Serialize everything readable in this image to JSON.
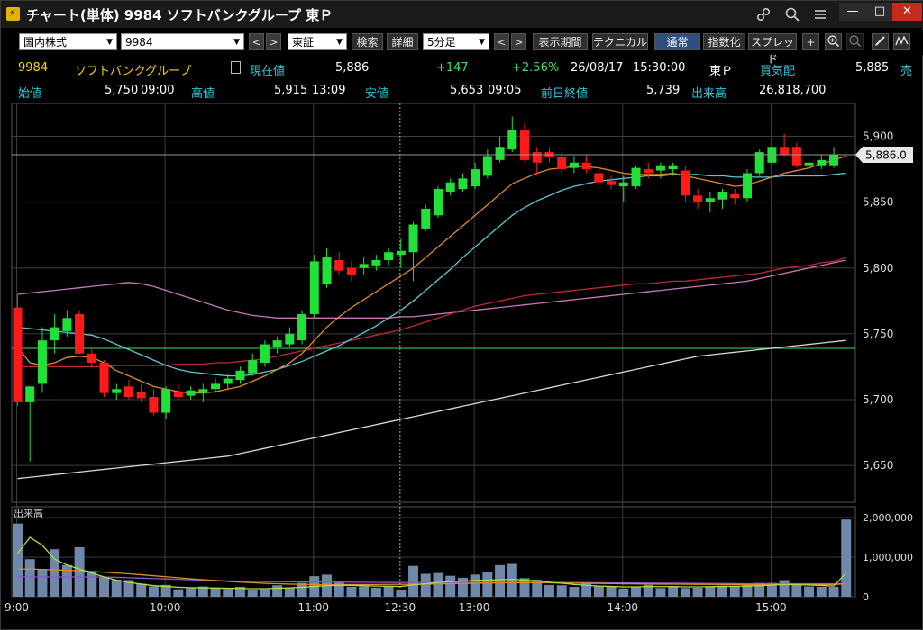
{
  "window": {
    "title": "チャート(単体) 9984 ソフトバンクグループ 東Ｐ",
    "icons": [
      "link-icon",
      "search-icon",
      "menu-icon"
    ],
    "minimize": "—",
    "maximize": "□",
    "close": "✕"
  },
  "toolbar": {
    "market_select": "国内株式",
    "code_input": "9984",
    "exchange_select": "東証",
    "search_button": "検索",
    "detail_button": "詳細",
    "interval_select": "5分足",
    "period_button": "表示期間",
    "technical_button": "テクニカル",
    "normal_button": "通常",
    "index_button": "指数化",
    "spread_button": "スプレッド"
  },
  "quote": {
    "code": "9984",
    "name": "ソフトバンクグループ",
    "current_label": "現在値",
    "current_value": "5,886",
    "change": "+147",
    "change_pct": "+2.56%",
    "date": "26/08/17",
    "time": "15:30:00",
    "market": "東Ｐ",
    "bid_label": "買気配",
    "bid_value": "5,885",
    "bid_suffix": "売",
    "open_label": "始値",
    "open_value": "5,750",
    "open_time": "09:00",
    "high_label": "高値",
    "high_value": "5,915",
    "high_time": "13:09",
    "low_label": "安値",
    "low_value": "5,653",
    "low_time": "09:05",
    "prev_label": "前日終値",
    "prev_value": "5,739",
    "volume_label": "出来高",
    "volume_value": "26,818,700"
  },
  "chart_data": {
    "type": "candlestick",
    "price_ticks": [
      "5,650",
      "5,700",
      "5,750",
      "5,800",
      "5,850",
      "5,900"
    ],
    "price_tick_values": [
      5650,
      5700,
      5750,
      5800,
      5850,
      5900
    ],
    "ylim": [
      5622,
      5925
    ],
    "current_price_label": "5,886.0",
    "current_price": 5886,
    "prev_close": 5739,
    "volume_label": "出来高",
    "volume_ticks": [
      "2,000,000",
      "1,000,000",
      "0"
    ],
    "volume_tick_values": [
      2000000,
      1000000,
      0
    ],
    "volume_max": 2000000,
    "time_labels": [
      "9:00",
      "10:00",
      "11:00",
      "12:30",
      "13:00",
      "14:00",
      "15:00"
    ],
    "time_label_index": [
      0,
      12,
      24,
      31,
      37,
      49,
      61
    ],
    "colors": {
      "up": "#22e03a",
      "down": "#ff1a1a",
      "ma1": "#e08a2a",
      "ma2": "#5ac8d8",
      "ma3": "#c0283a",
      "ma4": "#c878b8",
      "ma5": "#d8d8d8",
      "prev_close": "#3ce05a",
      "volume": "#6f87a8"
    },
    "candles": [
      {
        "o": 5770,
        "h": 5780,
        "l": 5695,
        "c": 5698
      },
      {
        "o": 5698,
        "h": 5710,
        "l": 5653,
        "c": 5710
      },
      {
        "o": 5712,
        "h": 5755,
        "l": 5705,
        "c": 5745
      },
      {
        "o": 5745,
        "h": 5765,
        "l": 5735,
        "c": 5755
      },
      {
        "o": 5752,
        "h": 5768,
        "l": 5748,
        "c": 5762
      },
      {
        "o": 5765,
        "h": 5768,
        "l": 5735,
        "c": 5735
      },
      {
        "o": 5735,
        "h": 5740,
        "l": 5725,
        "c": 5728
      },
      {
        "o": 5728,
        "h": 5730,
        "l": 5702,
        "c": 5705
      },
      {
        "o": 5705,
        "h": 5712,
        "l": 5700,
        "c": 5708
      },
      {
        "o": 5710,
        "h": 5715,
        "l": 5700,
        "c": 5702
      },
      {
        "o": 5706,
        "h": 5712,
        "l": 5698,
        "c": 5701
      },
      {
        "o": 5702,
        "h": 5708,
        "l": 5688,
        "c": 5690
      },
      {
        "o": 5690,
        "h": 5710,
        "l": 5685,
        "c": 5708
      },
      {
        "o": 5706,
        "h": 5712,
        "l": 5700,
        "c": 5702
      },
      {
        "o": 5703,
        "h": 5710,
        "l": 5700,
        "c": 5707
      },
      {
        "o": 5705,
        "h": 5712,
        "l": 5698,
        "c": 5708
      },
      {
        "o": 5708,
        "h": 5716,
        "l": 5705,
        "c": 5712
      },
      {
        "o": 5712,
        "h": 5720,
        "l": 5708,
        "c": 5716
      },
      {
        "o": 5715,
        "h": 5725,
        "l": 5712,
        "c": 5722
      },
      {
        "o": 5720,
        "h": 5735,
        "l": 5718,
        "c": 5730
      },
      {
        "o": 5728,
        "h": 5745,
        "l": 5725,
        "c": 5742
      },
      {
        "o": 5740,
        "h": 5748,
        "l": 5735,
        "c": 5745
      },
      {
        "o": 5742,
        "h": 5755,
        "l": 5740,
        "c": 5750
      },
      {
        "o": 5745,
        "h": 5768,
        "l": 5742,
        "c": 5765
      },
      {
        "o": 5765,
        "h": 5810,
        "l": 5762,
        "c": 5805
      },
      {
        "o": 5788,
        "h": 5815,
        "l": 5785,
        "c": 5808
      },
      {
        "o": 5806,
        "h": 5812,
        "l": 5795,
        "c": 5798
      },
      {
        "o": 5800,
        "h": 5805,
        "l": 5790,
        "c": 5795
      },
      {
        "o": 5800,
        "h": 5808,
        "l": 5795,
        "c": 5803
      },
      {
        "o": 5802,
        "h": 5810,
        "l": 5798,
        "c": 5806
      },
      {
        "o": 5806,
        "h": 5815,
        "l": 5802,
        "c": 5812
      },
      {
        "o": 5810,
        "h": 5822,
        "l": 5800,
        "c": 5813
      },
      {
        "o": 5812,
        "h": 5835,
        "l": 5790,
        "c": 5833
      },
      {
        "o": 5830,
        "h": 5848,
        "l": 5828,
        "c": 5845
      },
      {
        "o": 5840,
        "h": 5862,
        "l": 5838,
        "c": 5860
      },
      {
        "o": 5858,
        "h": 5868,
        "l": 5855,
        "c": 5865
      },
      {
        "o": 5860,
        "h": 5872,
        "l": 5858,
        "c": 5868
      },
      {
        "o": 5862,
        "h": 5880,
        "l": 5860,
        "c": 5875
      },
      {
        "o": 5870,
        "h": 5890,
        "l": 5868,
        "c": 5885
      },
      {
        "o": 5882,
        "h": 5900,
        "l": 5880,
        "c": 5892
      },
      {
        "o": 5890,
        "h": 5915,
        "l": 5888,
        "c": 5905
      },
      {
        "o": 5905,
        "h": 5910,
        "l": 5880,
        "c": 5882
      },
      {
        "o": 5888,
        "h": 5892,
        "l": 5870,
        "c": 5880
      },
      {
        "o": 5888,
        "h": 5892,
        "l": 5880,
        "c": 5884
      },
      {
        "o": 5884,
        "h": 5888,
        "l": 5872,
        "c": 5875
      },
      {
        "o": 5876,
        "h": 5885,
        "l": 5872,
        "c": 5880
      },
      {
        "o": 5880,
        "h": 5886,
        "l": 5872,
        "c": 5875
      },
      {
        "o": 5872,
        "h": 5876,
        "l": 5862,
        "c": 5865
      },
      {
        "o": 5866,
        "h": 5870,
        "l": 5860,
        "c": 5863
      },
      {
        "o": 5862,
        "h": 5870,
        "l": 5850,
        "c": 5865
      },
      {
        "o": 5862,
        "h": 5878,
        "l": 5860,
        "c": 5876
      },
      {
        "o": 5875,
        "h": 5880,
        "l": 5868,
        "c": 5872
      },
      {
        "o": 5874,
        "h": 5880,
        "l": 5868,
        "c": 5878
      },
      {
        "o": 5875,
        "h": 5880,
        "l": 5870,
        "c": 5878
      },
      {
        "o": 5874,
        "h": 5878,
        "l": 5850,
        "c": 5855
      },
      {
        "o": 5855,
        "h": 5860,
        "l": 5845,
        "c": 5850
      },
      {
        "o": 5850,
        "h": 5858,
        "l": 5842,
        "c": 5853
      },
      {
        "o": 5852,
        "h": 5860,
        "l": 5845,
        "c": 5858
      },
      {
        "o": 5856,
        "h": 5860,
        "l": 5848,
        "c": 5853
      },
      {
        "o": 5853,
        "h": 5875,
        "l": 5850,
        "c": 5872
      },
      {
        "o": 5872,
        "h": 5890,
        "l": 5870,
        "c": 5888
      },
      {
        "o": 5880,
        "h": 5898,
        "l": 5878,
        "c": 5892
      },
      {
        "o": 5892,
        "h": 5902,
        "l": 5885,
        "c": 5886
      },
      {
        "o": 5892,
        "h": 5895,
        "l": 5876,
        "c": 5878
      },
      {
        "o": 5878,
        "h": 5885,
        "l": 5874,
        "c": 5880
      },
      {
        "o": 5878,
        "h": 5886,
        "l": 5875,
        "c": 5882
      },
      {
        "o": 5878,
        "h": 5892,
        "l": 5876,
        "c": 5886
      }
    ],
    "volumes": [
      1850000,
      950000,
      700000,
      1200000,
      800000,
      1250000,
      620000,
      500000,
      430000,
      420000,
      330000,
      260000,
      300000,
      190000,
      220000,
      260000,
      230000,
      200000,
      250000,
      170000,
      190000,
      290000,
      230000,
      350000,
      520000,
      560000,
      400000,
      250000,
      260000,
      230000,
      280000,
      160000,
      780000,
      580000,
      600000,
      530000,
      480000,
      560000,
      630000,
      800000,
      830000,
      470000,
      430000,
      300000,
      290000,
      250000,
      330000,
      270000,
      250000,
      210000,
      250000,
      300000,
      220000,
      270000,
      220000,
      230000,
      250000,
      280000,
      270000,
      310000,
      350000,
      350000,
      420000,
      330000,
      260000,
      250000,
      250000,
      1950000
    ],
    "ma_fast": [
      5740,
      5728,
      5726,
      5728,
      5732,
      5733,
      5732,
      5728,
      5722,
      5718,
      5714,
      5710,
      5708,
      5706,
      5705,
      5705,
      5706,
      5708,
      5710,
      5714,
      5718,
      5723,
      5728,
      5735,
      5745,
      5755,
      5763,
      5770,
      5776,
      5782,
      5788,
      5794,
      5800,
      5808,
      5816,
      5824,
      5832,
      5840,
      5848,
      5856,
      5864,
      5868,
      5872,
      5875,
      5876,
      5877,
      5877,
      5876,
      5874,
      5872,
      5871,
      5871,
      5871,
      5872,
      5870,
      5868,
      5866,
      5864,
      5862,
      5863,
      5866,
      5869,
      5872,
      5874,
      5876,
      5879,
      5882,
      5885
    ],
    "ma_mid": [
      5755,
      5754,
      5753,
      5752,
      5751,
      5750,
      5749,
      5746,
      5742,
      5738,
      5734,
      5730,
      5726,
      5723,
      5721,
      5720,
      5719,
      5718,
      5718,
      5719,
      5721,
      5723,
      5726,
      5729,
      5733,
      5737,
      5741,
      5746,
      5751,
      5756,
      5762,
      5768,
      5775,
      5783,
      5791,
      5799,
      5808,
      5816,
      5824,
      5832,
      5840,
      5846,
      5851,
      5855,
      5859,
      5862,
      5864,
      5866,
      5867,
      5868,
      5869,
      5870,
      5870,
      5871,
      5871,
      5871,
      5870,
      5870,
      5869,
      5869,
      5869,
      5869,
      5870,
      5870,
      5870,
      5870,
      5871,
      5872
    ],
    "ma_slow": [
      5725,
      5725,
      5725,
      5725,
      5725,
      5725,
      5725,
      5725,
      5726,
      5726,
      5726,
      5726,
      5726,
      5727,
      5727,
      5727,
      5728,
      5728,
      5729,
      5730,
      5731,
      5733,
      5735,
      5737,
      5739,
      5741,
      5743,
      5745,
      5747,
      5749,
      5751,
      5753,
      5756,
      5759,
      5762,
      5765,
      5768,
      5771,
      5773,
      5775,
      5777,
      5779,
      5780,
      5781,
      5782,
      5783,
      5784,
      5785,
      5786,
      5787,
      5788,
      5788,
      5789,
      5790,
      5790,
      5791,
      5792,
      5793,
      5794,
      5795,
      5796,
      5798,
      5800,
      5801,
      5802,
      5804,
      5805,
      5808
    ],
    "ma_pink": [
      5780,
      5781,
      5782,
      5783,
      5784,
      5785,
      5786,
      5787,
      5788,
      5789,
      5788,
      5786,
      5783,
      5780,
      5777,
      5774,
      5771,
      5768,
      5766,
      5764,
      5763,
      5762,
      5762,
      5762,
      5762,
      5762,
      5762,
      5762,
      5762,
      5762,
      5762,
      5763,
      5763,
      5764,
      5765,
      5766,
      5767,
      5768,
      5769,
      5770,
      5771,
      5772,
      5773,
      5774,
      5775,
      5776,
      5777,
      5778,
      5779,
      5780,
      5781,
      5782,
      5783,
      5784,
      5785,
      5786,
      5787,
      5788,
      5789,
      5790,
      5792,
      5794,
      5796,
      5798,
      5800,
      5802,
      5804,
      5806
    ],
    "ma_long": [
      5640,
      5641,
      5642,
      5643,
      5644,
      5645,
      5646,
      5647,
      5648,
      5649,
      5650,
      5651,
      5652,
      5653,
      5654,
      5655,
      5656,
      5657,
      5659,
      5661,
      5663,
      5665,
      5667,
      5669,
      5671,
      5673,
      5675,
      5677,
      5679,
      5681,
      5683,
      5685,
      5687,
      5689,
      5691,
      5693,
      5695,
      5697,
      5699,
      5701,
      5703,
      5705,
      5707,
      5709,
      5711,
      5713,
      5715,
      5717,
      5719,
      5721,
      5723,
      5725,
      5727,
      5729,
      5731,
      5733,
      5734,
      5735,
      5736,
      5737,
      5738,
      5739,
      5740,
      5741,
      5742,
      5743,
      5744,
      5745
    ],
    "vol_ma_green": [
      1100000,
      1500000,
      1300000,
      950000,
      800000,
      700000,
      600000,
      500000,
      420000,
      360000,
      320000,
      280000,
      260000,
      240000,
      230000,
      225000,
      220000,
      215000,
      210000,
      205000,
      205000,
      215000,
      225000,
      240000,
      260000,
      280000,
      290000,
      285000,
      280000,
      270000,
      265000,
      260000,
      300000,
      330000,
      360000,
      380000,
      400000,
      410000,
      420000,
      430000,
      440000,
      420000,
      400000,
      370000,
      340000,
      310000,
      290000,
      270000,
      260000,
      250000,
      250000,
      255000,
      255000,
      255000,
      250000,
      250000,
      255000,
      260000,
      265000,
      270000,
      280000,
      295000,
      310000,
      305000,
      295000,
      285000,
      270000,
      600000
    ],
    "vol_ma_orange": [
      700000,
      700000,
      690000,
      680000,
      670000,
      655000,
      640000,
      620000,
      600000,
      580000,
      555000,
      530000,
      505000,
      480000,
      455000,
      430000,
      410000,
      390000,
      370000,
      355000,
      340000,
      330000,
      320000,
      315000,
      310000,
      310000,
      310000,
      310000,
      310000,
      310000,
      312000,
      314000,
      316000,
      320000,
      325000,
      330000,
      335000,
      340000,
      345000,
      350000,
      355000,
      355000,
      355000,
      352000,
      348000,
      344000,
      340000,
      336000,
      332000,
      328000,
      325000,
      322000,
      320000,
      318000,
      316000,
      314000,
      312000,
      310000,
      308000,
      308000,
      308000,
      308000,
      308000,
      308000,
      308000,
      308000,
      308000,
      330000
    ],
    "vol_ma_purple": [
      500000,
      500000,
      500000,
      500000,
      500000,
      500000,
      500000,
      500000,
      490000,
      480000,
      470000,
      460000,
      450000,
      440000,
      430000,
      420000,
      410000,
      400000,
      395000,
      390000,
      385000,
      380000,
      378000,
      376000,
      374000,
      372000,
      370000,
      368000,
      366000,
      364000,
      362000,
      360000,
      360000,
      360000,
      360000,
      360000,
      360000,
      360000,
      360000,
      360000,
      360000,
      360000,
      360000,
      360000,
      360000,
      358000,
      356000,
      354000,
      352000,
      350000,
      348000,
      346000,
      344000,
      342000,
      340000,
      338000,
      336000,
      334000,
      332000,
      330000,
      330000,
      330000,
      330000,
      330000,
      330000,
      330000,
      330000,
      340000
    ]
  }
}
